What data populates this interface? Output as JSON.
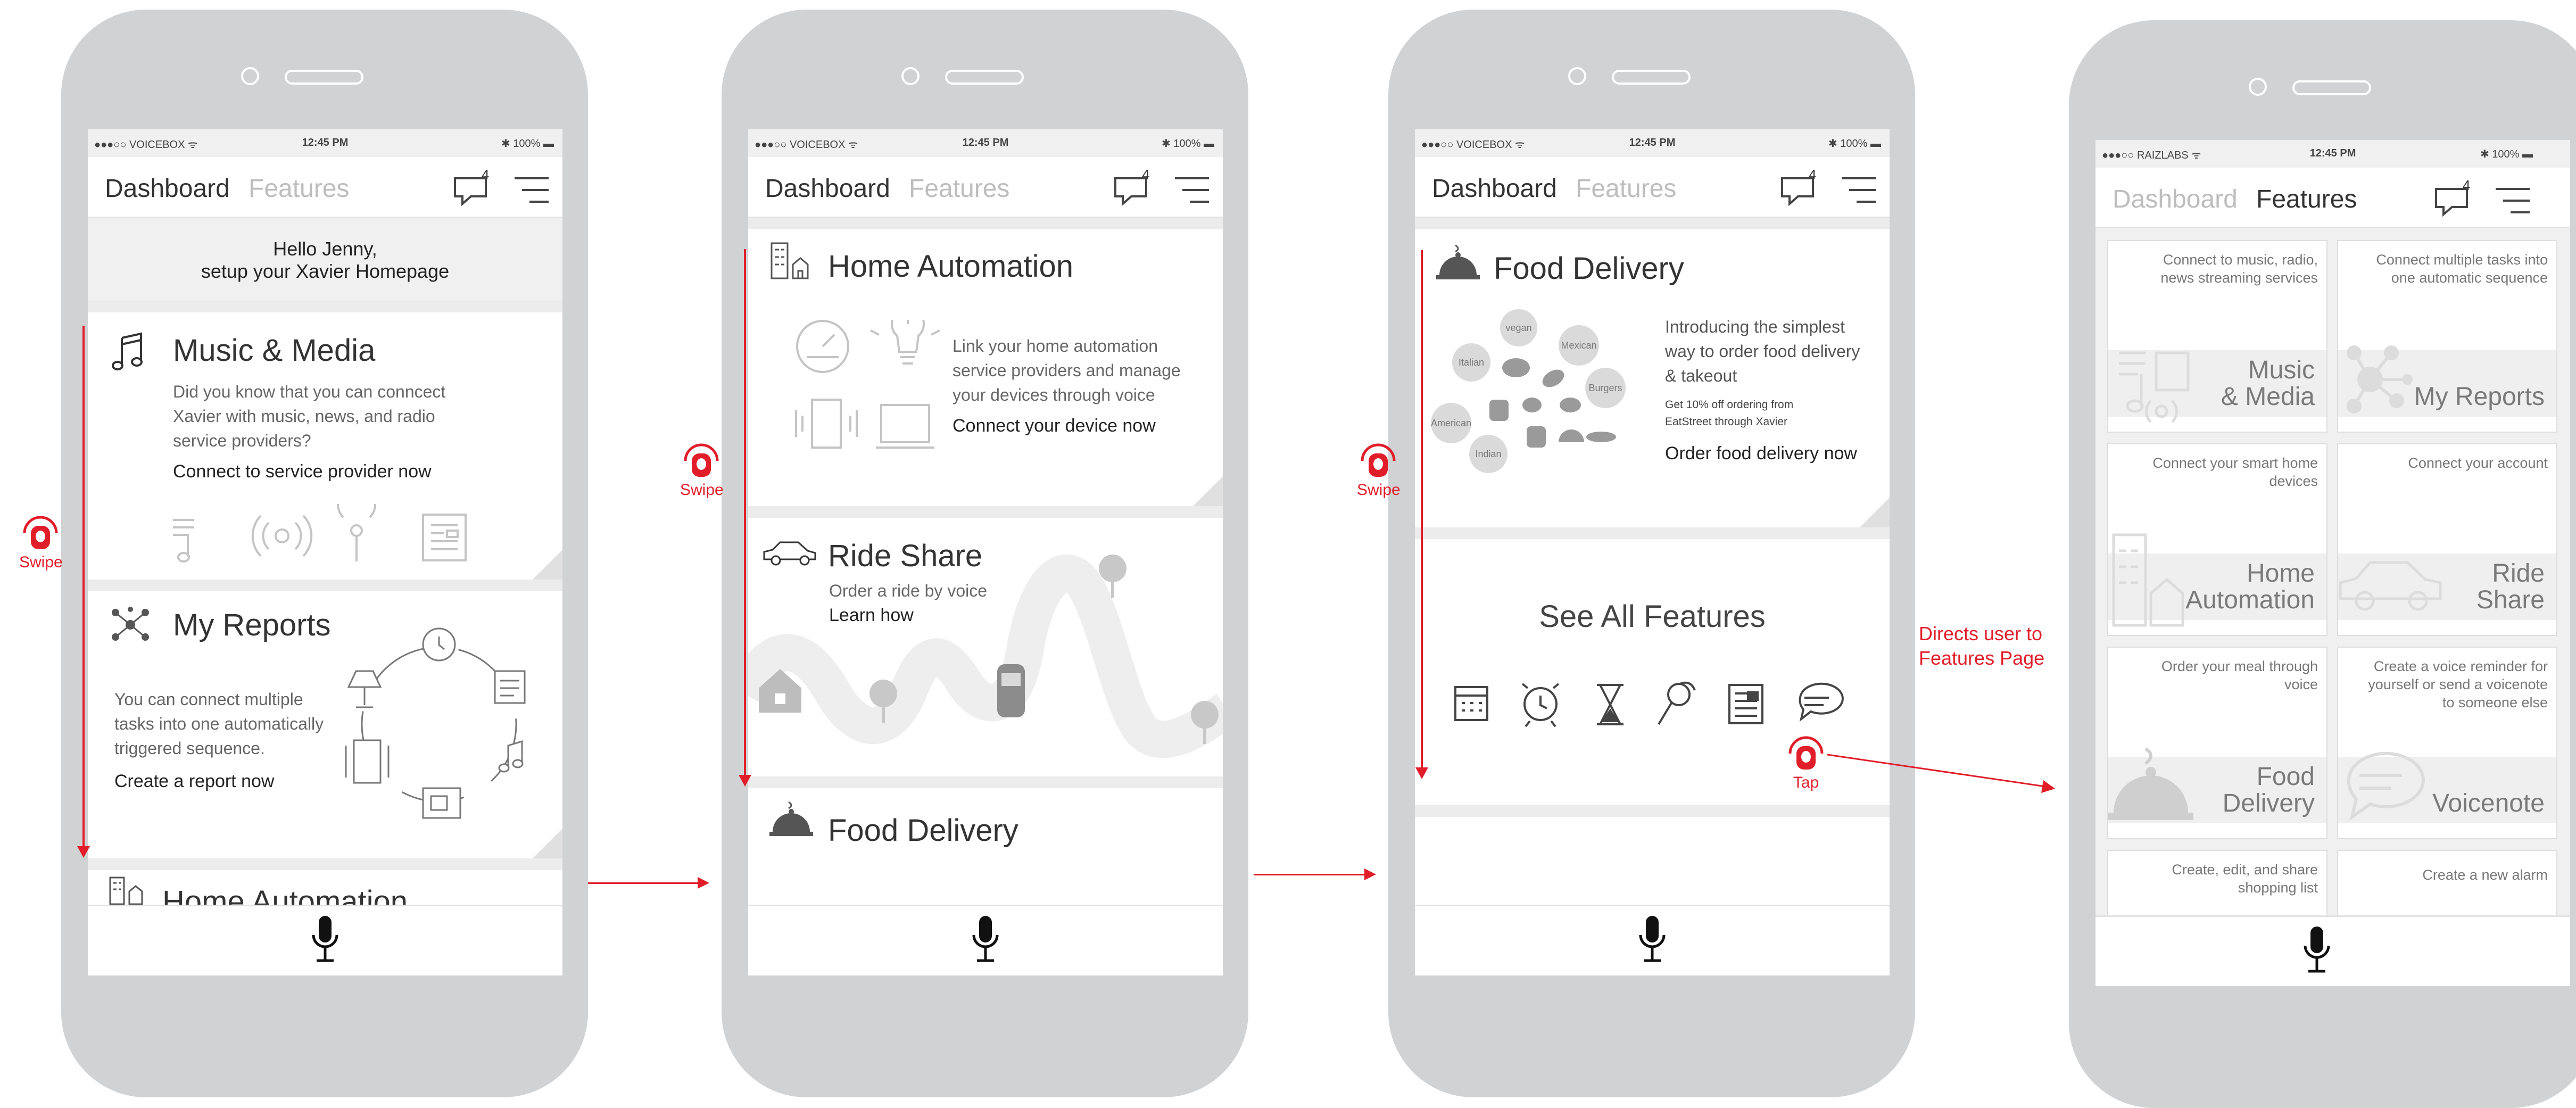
{
  "colors": {
    "accent": "#e11d2a",
    "frame": "#d1d2d4",
    "icon": "#bfbfbf"
  },
  "phones": [
    {
      "status": {
        "carrier": "●●●○○ VOICEBOX ᯤ",
        "time": "12:45 PM",
        "battery": "✱ 100% ▬"
      },
      "nav": {
        "tab_active": "Dashboard",
        "tab_inactive": "Features",
        "badge": "4"
      },
      "greeting": {
        "line1": "Hello Jenny,",
        "line2": "setup your Xavier Homepage"
      },
      "music": {
        "title": "Music & Media",
        "body": [
          "Did you know that you can conncect",
          "Xavier with music, news, and radio",
          "service providers?"
        ],
        "link": "Connect to service provider now"
      },
      "reports": {
        "title": "My Reports",
        "body": [
          "You can connect multiple",
          "tasks into one automatically",
          "triggered sequence."
        ],
        "link": "Create a report now"
      },
      "peek": {
        "title": "Home Automation"
      }
    },
    {
      "status": {
        "carrier": "●●●○○ VOICEBOX ᯤ",
        "time": "12:45 PM",
        "battery": "✱ 100% ▬"
      },
      "nav": {
        "tab_active": "Dashboard",
        "tab_inactive": "Features",
        "badge": "4"
      },
      "home": {
        "title": "Home Automation",
        "body": [
          "Link your home automation",
          "service providers and manage",
          "your devices through voice"
        ],
        "link": "Connect your device now"
      },
      "ride": {
        "title": "Ride Share",
        "body": "Order a ride by voice",
        "link": "Learn how"
      },
      "peek": {
        "title": "Food Delivery"
      }
    },
    {
      "status": {
        "carrier": "●●●○○ VOICEBOX ᯤ",
        "time": "12:45 PM",
        "battery": "✱ 100% ▬"
      },
      "nav": {
        "tab_active": "Dashboard",
        "tab_inactive": "Features",
        "badge": "4"
      },
      "food": {
        "title": "Food Delivery",
        "body": [
          "Introducing the simplest",
          "way to order food delivery",
          "& takeout"
        ],
        "promo": [
          "Get 10% off ordering from",
          "EatStreet through Xavier"
        ],
        "link": "Order food delivery now",
        "cuisines": [
          "vegan",
          "Mexican",
          "Italian",
          "Burgers",
          "American",
          "Indian"
        ]
      },
      "see_all": "See All Features"
    },
    {
      "status": {
        "carrier": "●●●○○ RAIZLABS ᯤ",
        "time": "12:45 PM",
        "battery": "✱ 100% ▬"
      },
      "nav": {
        "tab_inactive": "Dashboard",
        "tab_active": "Features",
        "badge": "4"
      },
      "features": [
        {
          "desc": "Connect to music, radio, news streaming services",
          "name": "Music\n& Media"
        },
        {
          "desc": "Connect multiple tasks into one automatic sequence",
          "name": "My Reports"
        },
        {
          "desc": "Connect your smart home devices",
          "name": "Home\nAutomation"
        },
        {
          "desc": "Connect your account",
          "name": "Ride\nShare"
        },
        {
          "desc": "Order your meal through voice",
          "name": "Food\nDelivery"
        },
        {
          "desc": "Create a voice reminder for yourself or send a voicenote to someone else",
          "name": "Voicenote"
        },
        {
          "desc": "Create, edit, and share shopping list",
          "name": ""
        },
        {
          "desc": "Create a new alarm",
          "name": ""
        }
      ]
    }
  ],
  "annotations": {
    "swipe": "Swipe",
    "tap": "Tap",
    "directs": [
      "Directs user to",
      "Features Page"
    ]
  }
}
